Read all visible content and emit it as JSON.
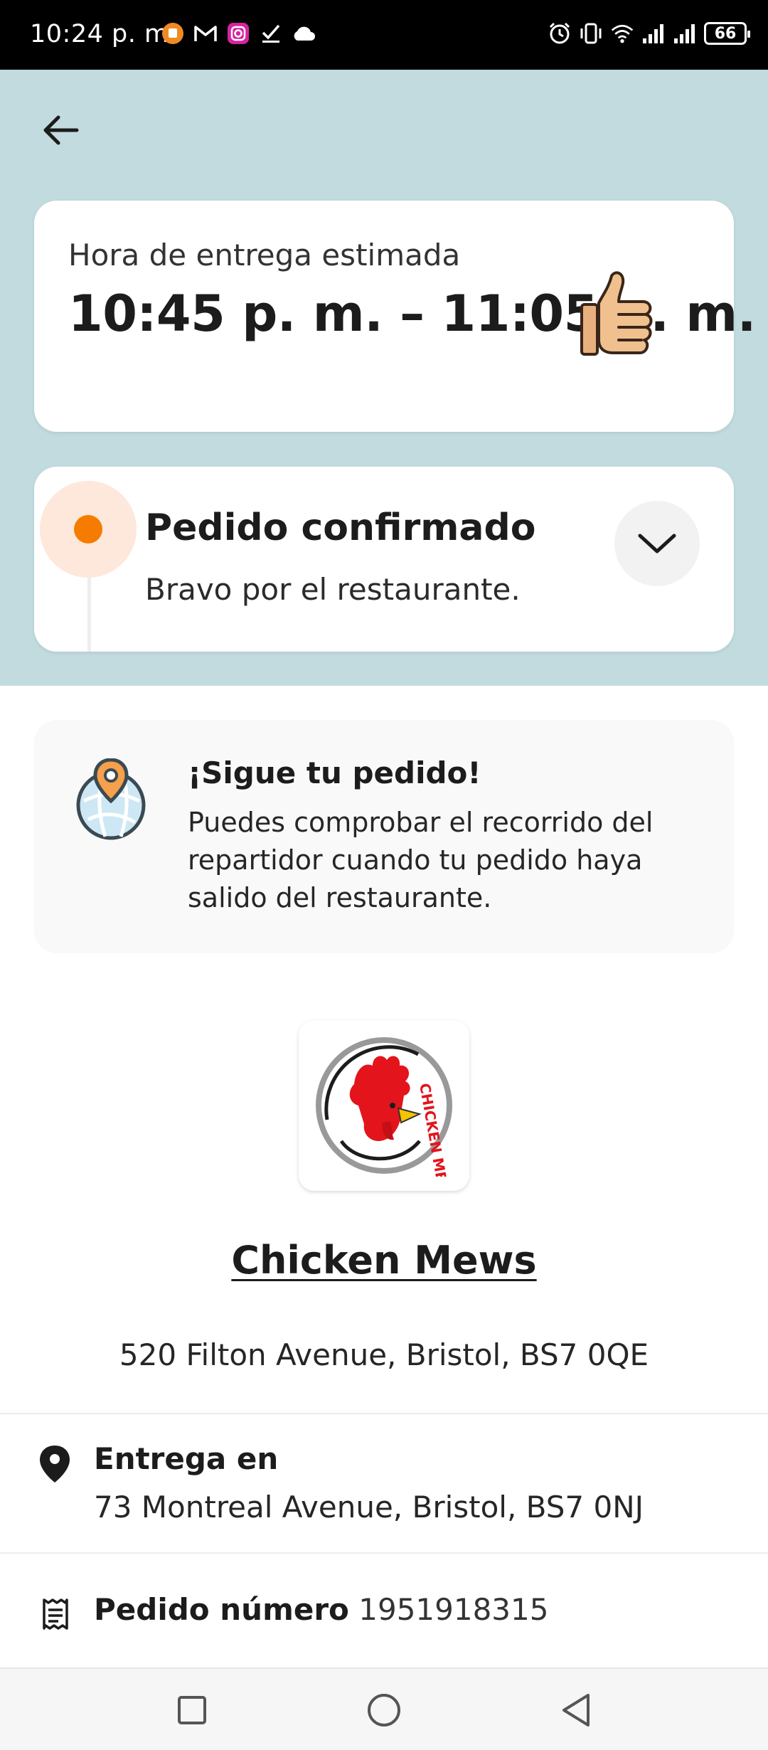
{
  "status_bar": {
    "time": "10:24 p. m.",
    "battery": "66",
    "left_icons": [
      "app-notification-icon",
      "gmail-icon",
      "instagram-icon",
      "checkmark-icon",
      "cloud-icon"
    ],
    "right_icons": [
      "alarm-icon",
      "vibrate-icon",
      "wifi-icon",
      "signal-icon",
      "signal-icon",
      "battery-icon"
    ]
  },
  "eta": {
    "label": "Hora de entrega estimada",
    "value": "10:45 p. m. – 11:05 p. m."
  },
  "order_status": {
    "title": "Pedido confirmado",
    "subtitle": "Bravo por el restaurante."
  },
  "tracking": {
    "title": "¡Sigue tu pedido!",
    "body": "Puedes comprobar el recorrido del repartidor cuando tu pedido haya salido del restaurante."
  },
  "restaurant": {
    "name": "Chicken Mews",
    "address": "520 Filton Avenue, Bristol, BS7 0QE",
    "logo_text": "CHICKEN MEWS"
  },
  "delivery": {
    "label": "Entrega en",
    "address": "73 Montreal Avenue, Bristol, BS7 0NJ"
  },
  "order": {
    "label": "Pedido número",
    "number": "1951918315"
  },
  "colors": {
    "header_bg": "#c2dbdf",
    "accent_orange": "#f57c00",
    "card_bg": "#ffffff"
  }
}
